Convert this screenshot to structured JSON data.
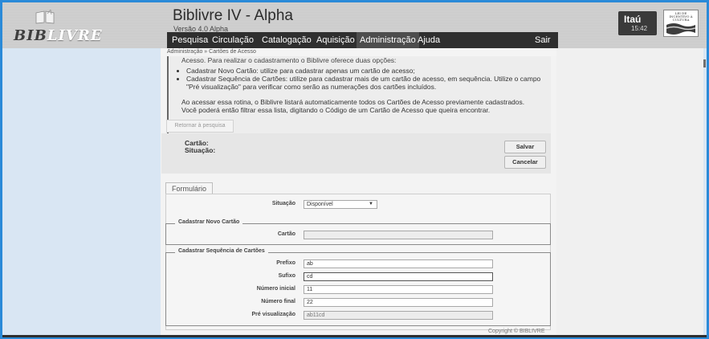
{
  "app": {
    "logo_text_1": "BIB",
    "logo_text_2": "LIVRE",
    "title": "Biblivre IV - Alpha",
    "version": "Versão 4.0 Alpha"
  },
  "menu": [
    {
      "label": "Pesquisa"
    },
    {
      "label": "Circulação"
    },
    {
      "label": "Catalogação"
    },
    {
      "label": "Aquisição"
    },
    {
      "label": "Administração",
      "active": true
    },
    {
      "label": "Ajuda"
    },
    {
      "label": "Sair"
    }
  ],
  "sponsor": {
    "name": "Itaú",
    "time": "15:42",
    "seal_text": "LEI DE INCENTIVO À CULTURA"
  },
  "breadcrumb": "Administração » Cartões de Acesso",
  "info": {
    "line1": "Acesso. Para realizar o cadastramento o Biblivre oferece duas opções:",
    "bullet1": "Cadastrar Novo Cartão: utilize para cadastrar apenas um cartão de acesso;",
    "bullet2": "Cadastrar Sequência de Cartões: utilize para cadastrar mais de um cartão de acesso, em sequência. Utilize o campo \"Pré visualização\" para verificar como serão as numerações dos cartões incluídos.",
    "para1": "Ao acessar essa rotina, o Biblivre listará automaticamente todos os Cartões de Acesso previamente cadastrados.",
    "para2": "Você poderá então filtrar essa lista, digitando o Código de um Cartão de Acesso que queira encontrar."
  },
  "back_button": "Retornar à pesquisa",
  "summary": {
    "card_label": "Cartão:",
    "status_label": "Situação:"
  },
  "actions": {
    "save": "Salvar",
    "cancel": "Cancelar"
  },
  "form": {
    "tab": "Formulário",
    "status_label": "Situação",
    "status_value": "Disponível",
    "new_card_legend": "Cadastrar Novo Cartão",
    "card_label": "Cartão",
    "card_value": "",
    "sequence_legend": "Cadastrar Sequência de Cartões",
    "prefix_label": "Prefixo",
    "prefix_value": "ab",
    "suffix_label": "Sufixo",
    "suffix_value": "cd",
    "start_label": "Número inicial",
    "start_value": "11",
    "end_label": "Número final",
    "end_value": "22",
    "preview_label": "Pré visualização",
    "preview_value": "ab11cd"
  },
  "footer": {
    "copyright": "Copyright © BIBLIVRE"
  }
}
